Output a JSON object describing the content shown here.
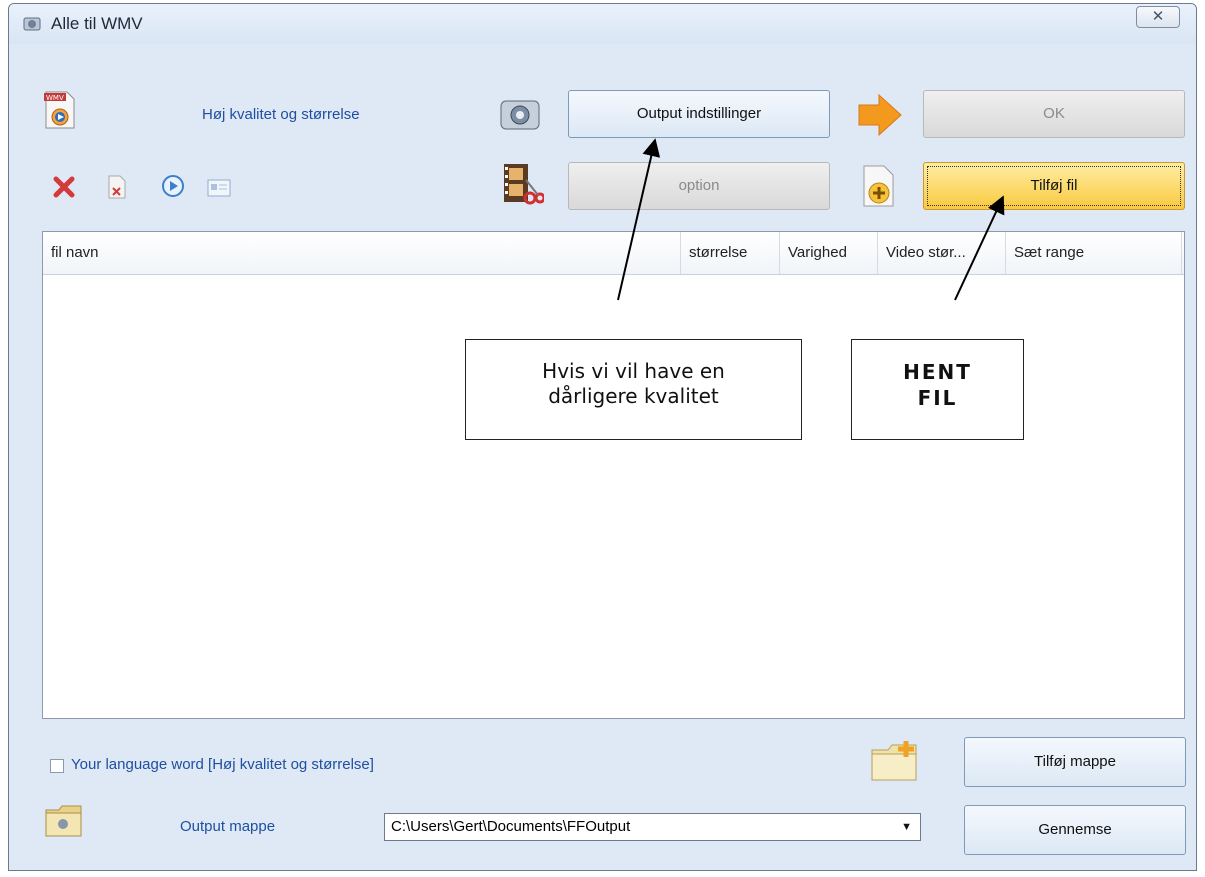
{
  "window": {
    "title": "Alle til WMV",
    "close_glyph": "✕"
  },
  "top": {
    "preset_label": "Høj kvalitet  og størrelse",
    "output_settings_button": "Output indstillinger",
    "ok_button": "OK",
    "option_button": "option",
    "add_file_button": "Tilføj fil"
  },
  "list": {
    "columns": [
      "fil navn",
      "størrelse",
      "Varighed",
      "Video stør...",
      "Sæt range"
    ]
  },
  "callouts": {
    "quality_line1": "Hvis vi vil have en",
    "quality_line2": "dårligere kvalitet",
    "fetch_line1": "HENT",
    "fetch_line2": "FIL"
  },
  "bottom": {
    "checkbox_label": "Your language word [Høj kvalitet  og størrelse]",
    "add_folder_button": "Tilføj mappe",
    "output_folder_label": "Output mappe",
    "output_path": "C:\\Users\\Gert\\Documents\\FFOutput",
    "browse_button": "Gennemse"
  },
  "icons": {
    "title": "app-icon",
    "wmv": "wmv-file-icon",
    "remove": "remove-icon",
    "clear": "clear-icon",
    "play": "play-icon",
    "info": "info-icon",
    "settings": "settings-icon",
    "film_cut": "film-cut-icon",
    "arrow": "arrow-right-icon",
    "add_file": "add-file-icon",
    "add_folder": "add-folder-icon",
    "folder": "folder-icon"
  },
  "colors": {
    "window_bg": "#dfe9f5",
    "label_blue": "#1f4fa0",
    "accent_yellow": "#f9c93f",
    "arrow_orange": "#f39a1e"
  }
}
